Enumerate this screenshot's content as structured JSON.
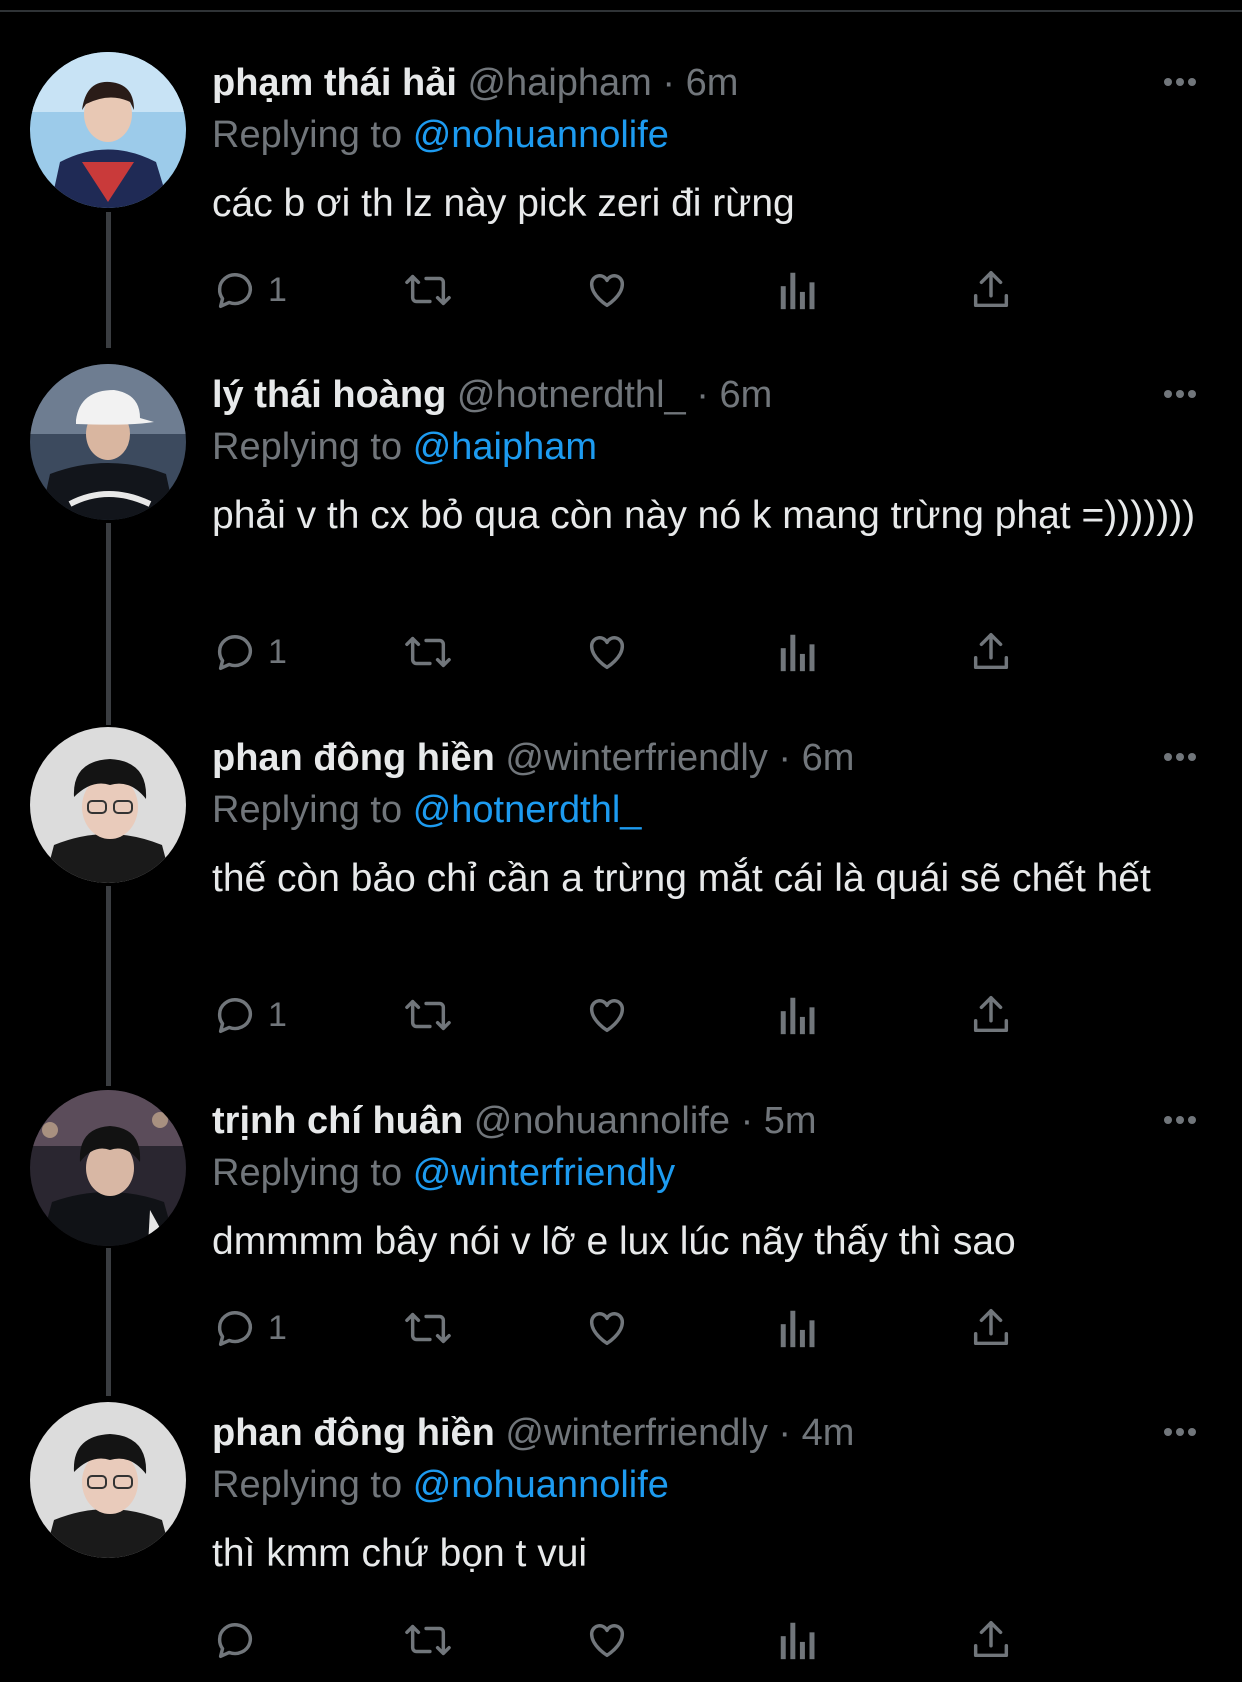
{
  "tweets": [
    {
      "name": "phạm thái hải",
      "handle": "@haipham",
      "separator": "·",
      "time": "6m",
      "replying_prefix": "Replying to",
      "replying_to": "@nohuannolife",
      "text": "các b ơi th lz này pick zeri đi rừng",
      "reply_count": "1"
    },
    {
      "name": "lý thái hoàng",
      "handle": "@hotnerdthl_",
      "separator": "·",
      "time": "6m",
      "replying_prefix": "Replying to",
      "replying_to": "@haipham",
      "text": "phải v th cx bỏ qua còn này nó k mang trừng phạt =)))))))",
      "reply_count": "1"
    },
    {
      "name": "phan đông hiền",
      "handle": "@winterfriendly",
      "separator": "·",
      "time": "6m",
      "replying_prefix": "Replying to",
      "replying_to": "@hotnerdthl_",
      "text": "thế còn bảo chỉ cần a trừng mắt cái là quái sẽ chết hết",
      "reply_count": "1"
    },
    {
      "name": "trịnh chí huân",
      "handle": "@nohuannolife",
      "separator": "·",
      "time": "5m",
      "replying_prefix": "Replying to",
      "replying_to": "@winterfriendly",
      "text": "dmmmm bây nói v lỡ e lux lúc nãy thấy thì sao",
      "reply_count": "1"
    },
    {
      "name": "phan đông hiền",
      "handle": "@winterfriendly",
      "separator": "·",
      "time": "4m",
      "replying_prefix": "Replying to",
      "replying_to": "@nohuannolife",
      "text": "thì kmm chứ bọn t vui",
      "reply_count": ""
    }
  ],
  "colors": {
    "background": "#000000",
    "text": "#e7e9ea",
    "muted": "#71767b",
    "accent": "#1d9bf0"
  },
  "icons": [
    "reply-icon",
    "retweet-icon",
    "like-icon",
    "views-icon",
    "share-icon",
    "more-icon"
  ]
}
